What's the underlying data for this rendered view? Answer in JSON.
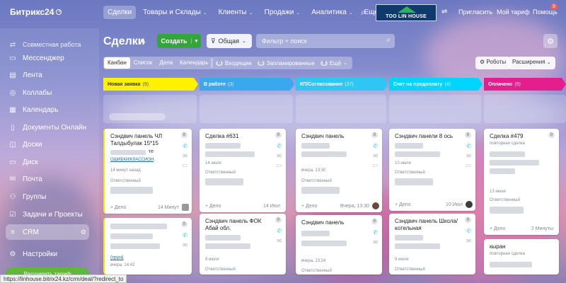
{
  "app": {
    "name": "Битрикс24"
  },
  "topnav": [
    {
      "label": "Сделки",
      "active": true
    },
    {
      "label": "Товары и Склады"
    },
    {
      "label": "Клиенты"
    },
    {
      "label": "Продажи"
    },
    {
      "label": "Аналитика"
    },
    {
      "label": "Еще"
    }
  ],
  "header": {
    "brand": "TOO LIN HOUSE",
    "invite": "Пригласить",
    "tariff": "Мой тариф",
    "help": "Помощь",
    "help_badge": "9"
  },
  "sidebar": {
    "section": "Совместная работа",
    "items": [
      {
        "label": "Мессенджер",
        "icon": "chat-icon"
      },
      {
        "label": "Лента",
        "icon": "feed-icon"
      },
      {
        "label": "Коллабы",
        "icon": "collab-icon"
      },
      {
        "label": "Календарь",
        "icon": "calendar-icon"
      },
      {
        "label": "Документы Онлайн",
        "icon": "document-icon"
      },
      {
        "label": "Доски",
        "icon": "board-icon"
      },
      {
        "label": "Диск",
        "icon": "disk-icon"
      },
      {
        "label": "Почта",
        "icon": "mail-icon"
      },
      {
        "label": "Группы",
        "icon": "groups-icon"
      },
      {
        "label": "Задачи и Проекты",
        "icon": "tasks-icon"
      },
      {
        "label": "CRM",
        "icon": "crm-icon",
        "active": true
      },
      {
        "label": "Настройки",
        "icon": "settings-icon"
      }
    ],
    "tariff_button": "Расширить тариф"
  },
  "page": {
    "title": "Сделки",
    "create": "Создать",
    "filter_preset": "Общая",
    "search_placeholder": "Фильтр + поиск"
  },
  "views": [
    "Канбан",
    "Список",
    "Дела",
    "Календарь"
  ],
  "counters": [
    {
      "count": "0",
      "label": "Входящие"
    },
    {
      "count": "0",
      "label": "Запланированные"
    },
    {
      "count": "3",
      "label": "Ещё"
    }
  ],
  "toolbar": {
    "robots": "Роботы",
    "extensions": "Расширения"
  },
  "stages": [
    {
      "label": "Новая заявка",
      "count": "(9)",
      "color": "#fff200"
    },
    {
      "label": "В работе",
      "count": "(3)",
      "color": "#39a8ef"
    },
    {
      "label": "КП/Согласование",
      "count": "(37)",
      "color": "#2fc6f6"
    },
    {
      "label": "Счет на предоплату",
      "count": "(4)",
      "color": "#00d5ff"
    },
    {
      "label": "Оплачено",
      "count": "(5)",
      "color": "#e41e8c"
    }
  ],
  "cards": [
    {
      "title": "Сэндвич панель ЧЛ Талдыбулак 15*15",
      "num": "0",
      "meta": "14 минут назад",
      "link": "ОШИБКИ/КЛАССИОН",
      "resp": "Ответственный",
      "date": "14 Минут",
      "add": "+ Дело",
      "tail": "те"
    },
    {
      "title": "Сделка #631",
      "num": "0",
      "meta": "14 июля",
      "resp": "Ответственный",
      "date": "14 Июл",
      "add": "+ Дело"
    },
    {
      "title": "Сэндвич панель",
      "num": "0",
      "meta": "вчера, 13:30",
      "resp": "Ответственный",
      "date": "Вчера, 13:30",
      "add": "+ Дело"
    },
    {
      "title": "Сэндвич панели 8 ось",
      "num": "0",
      "meta": "10 июля",
      "resp": "Ответственный",
      "date": "10 Июл",
      "add": "+ Дело"
    },
    {
      "title": "Сделка #479",
      "num": "0",
      "meta": "повторная сделка",
      "meta2": "13 июня",
      "resp": "Ответственный",
      "date": "2 Минуты",
      "add": "+ Дело"
    },
    {
      "title": "",
      "num": "0",
      "meta": "вчера, 14:42",
      "link": "(грун)"
    },
    {
      "title": "Сэндвич панель ФОК Абай обл.",
      "num": "0",
      "meta": "9 июля",
      "resp": "Ответственный"
    },
    {
      "title": "Сэндвич панель",
      "num": "0",
      "meta": "вчера, 13:24",
      "resp": "Ответственный"
    },
    {
      "title": "Сэндвич панель Школа/ котельная",
      "num": "0",
      "meta": "9 июля",
      "resp": "Ответственный"
    },
    {
      "title": "кыран",
      "meta": "повторная сделка"
    }
  ],
  "status_url": "https://linhouse.bitrix24.kz/crm/deal/?redirect_to"
}
